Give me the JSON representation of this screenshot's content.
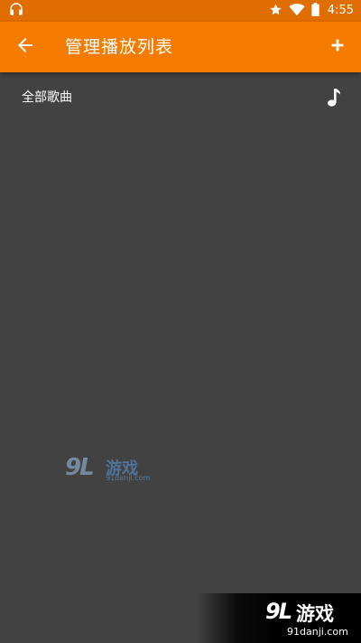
{
  "status_bar": {
    "time": "4:55",
    "icons": [
      "headphones-icon",
      "star-icon",
      "wifi-icon",
      "battery-icon"
    ]
  },
  "app_bar": {
    "title": "管理播放列表",
    "back_icon": "arrow-back-icon",
    "add_icon": "add-icon",
    "color": "#f57c00"
  },
  "playlists": [
    {
      "label": "全部歌曲",
      "icon": "music-note-icon"
    }
  ],
  "watermark_center": {
    "logo": "9L",
    "title": "游戏",
    "url": "91danji.com"
  },
  "watermark_corner": {
    "logo": "9L",
    "title": "游戏",
    "url": "91danji.com"
  },
  "colors": {
    "background": "#424242",
    "status_bar": "#e06d00",
    "app_bar": "#f57c00",
    "text": "#ffffff"
  }
}
